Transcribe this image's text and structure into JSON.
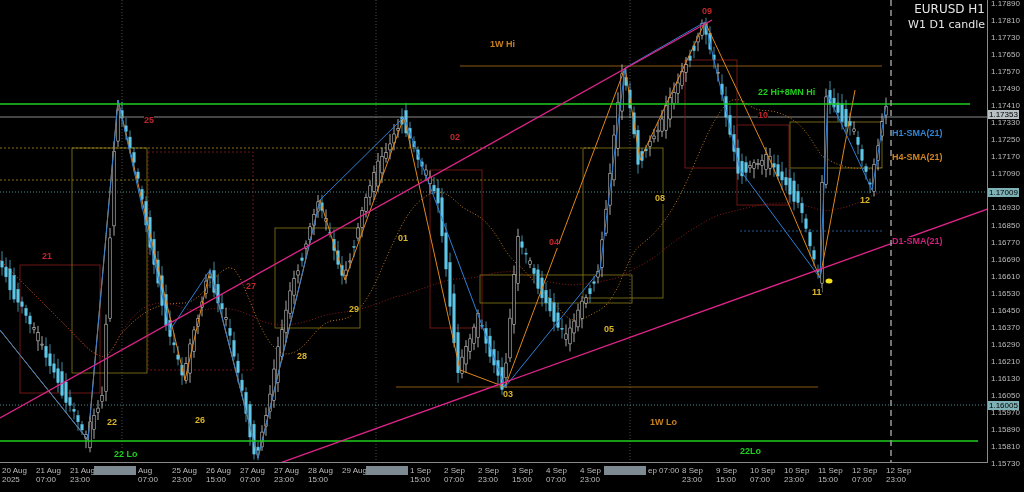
{
  "chart": {
    "symbol": "EURUSD H1",
    "subtitle": "W1 D1 candle",
    "annotations": [
      {
        "text": "1W Hi",
        "color": "#c8801e"
      },
      {
        "text": "22 Hi+8MN Hi",
        "color": "#1fcf1f"
      },
      {
        "text": "H1-SMA(21)",
        "color": "#2f86d6"
      },
      {
        "text": "H4-SMA(21)",
        "color": "#d0851e"
      },
      {
        "text": "D1-SMA(21)",
        "color": "#d01f7c"
      },
      {
        "text": "1W Lo",
        "color": "#c8801e"
      },
      {
        "text": "22Lo",
        "color": "#1fcf1f"
      },
      {
        "text": "22 Lo",
        "color": "#1fcf1f"
      }
    ],
    "swing_labels": [
      {
        "text": "21",
        "color": "#c0262b"
      },
      {
        "text": "25",
        "color": "#c0262b"
      },
      {
        "text": "27",
        "color": "#c0262b"
      },
      {
        "text": "02",
        "color": "#c0262b"
      },
      {
        "text": "04",
        "color": "#c0262b"
      },
      {
        "text": "09",
        "color": "#c0262b"
      },
      {
        "text": "10",
        "color": "#c0262b"
      },
      {
        "text": "22",
        "color": "#d9b52a"
      },
      {
        "text": "26",
        "color": "#d9b52a"
      },
      {
        "text": "28",
        "color": "#d9b52a"
      },
      {
        "text": "29",
        "color": "#d9b52a"
      },
      {
        "text": "01",
        "color": "#d9b52a"
      },
      {
        "text": "03",
        "color": "#d9b52a"
      },
      {
        "text": "05",
        "color": "#d9b52a"
      },
      {
        "text": "08",
        "color": "#d9b52a"
      },
      {
        "text": "11",
        "color": "#d9b52a"
      },
      {
        "text": "12",
        "color": "#d9b52a"
      }
    ],
    "price_axis": [
      "1.17890",
      "1.17810",
      "1.17730",
      "1.17650",
      "1.17570",
      "1.17490",
      "1.17410",
      "1.17330",
      "1.17250",
      "1.17170",
      "1.17090",
      "1.16930",
      "1.16850",
      "1.16770",
      "1.16690",
      "1.16610",
      "1.16530",
      "1.16450",
      "1.16370",
      "1.16290",
      "1.16210",
      "1.16130",
      "1.16050",
      "1.15970",
      "1.15890",
      "1.15810",
      "1.15730"
    ],
    "price_tags": [
      "1.17353",
      "1.17009",
      "1.16005"
    ],
    "time_axis": [
      {
        "kind": "tick",
        "label": "20 Aug 2025"
      },
      {
        "kind": "tick",
        "label": "21 Aug 07:00"
      },
      {
        "kind": "tick",
        "label": "21 Aug 23:00"
      },
      {
        "kind": "marker"
      },
      {
        "kind": "tick",
        "label": "Aug 07:00"
      },
      {
        "kind": "tick",
        "label": "25 Aug 23:00"
      },
      {
        "kind": "tick",
        "label": "26 Aug 15:00"
      },
      {
        "kind": "tick",
        "label": "27 Aug 07:00"
      },
      {
        "kind": "tick",
        "label": "27 Aug 23:00"
      },
      {
        "kind": "tick",
        "label": "28 Aug 15:00"
      },
      {
        "kind": "tick",
        "label": "29 Aug"
      },
      {
        "kind": "marker"
      },
      {
        "kind": "tick",
        "label": "1 Sep 15:00"
      },
      {
        "kind": "tick",
        "label": "2 Sep 07:00"
      },
      {
        "kind": "tick",
        "label": "2 Sep 23:00"
      },
      {
        "kind": "tick",
        "label": "3 Sep 15:00"
      },
      {
        "kind": "tick",
        "label": "4 Sep 07:00"
      },
      {
        "kind": "tick",
        "label": "4 Sep 23:00"
      },
      {
        "kind": "marker"
      },
      {
        "kind": "tick",
        "label": "ep 07:00"
      },
      {
        "kind": "tick",
        "label": "8 Sep 23:00"
      },
      {
        "kind": "tick",
        "label": "9 Sep 15:00"
      },
      {
        "kind": "tick",
        "label": "10 Sep 07:00"
      },
      {
        "kind": "tick",
        "label": "10 Sep 23:00"
      },
      {
        "kind": "tick",
        "label": "11 Sep 15:00"
      },
      {
        "kind": "tick",
        "label": "12 Sep 07:00"
      },
      {
        "kind": "tick",
        "label": "12 Sep 23:00"
      }
    ]
  }
}
